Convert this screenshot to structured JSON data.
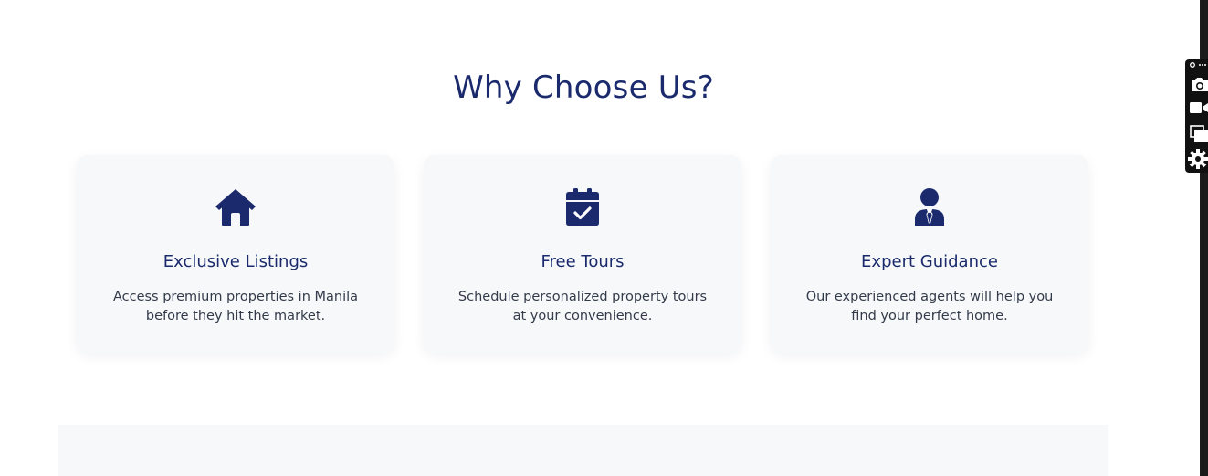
{
  "section": {
    "heading": "Why Choose Us?"
  },
  "cards": [
    {
      "icon": "house-icon",
      "title": "Exclusive Listings",
      "description": "Access premium properties in Manila before they hit the market."
    },
    {
      "icon": "calendar-check-icon",
      "title": "Free Tours",
      "description": "Schedule personalized property tours at your convenience."
    },
    {
      "icon": "user-tie-icon",
      "title": "Expert Guidance",
      "description": "Our experienced agents will help you find your perfect home."
    }
  ],
  "toolbar": {
    "tools": [
      "link-more-icon",
      "camera-icon",
      "video-icon",
      "window-icon",
      "gear-icon"
    ]
  },
  "colors": {
    "accent": "#1a2a6c",
    "card_bg": "#f7f8fa",
    "body_text": "#333b4a"
  }
}
